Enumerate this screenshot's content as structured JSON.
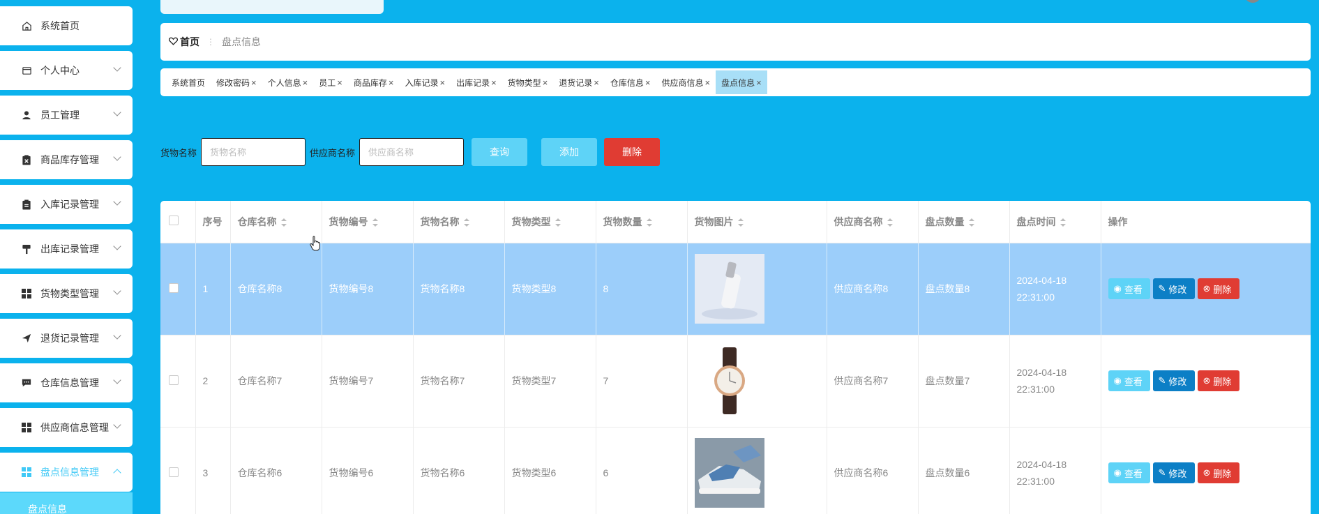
{
  "sidebar": {
    "items": [
      {
        "label": "系统首页",
        "icon": "home-icon",
        "arrow": false
      },
      {
        "label": "个人中心",
        "icon": "wallet-icon",
        "arrow": true
      },
      {
        "label": "员工管理",
        "icon": "user-icon",
        "arrow": true
      },
      {
        "label": "商品库存管理",
        "icon": "clipboard-x-icon",
        "arrow": true
      },
      {
        "label": "入库记录管理",
        "icon": "clipboard-icon",
        "arrow": true
      },
      {
        "label": "出库记录管理",
        "icon": "paint-roller-icon",
        "arrow": true
      },
      {
        "label": "货物类型管理",
        "icon": "grid-icon",
        "arrow": true
      },
      {
        "label": "退货记录管理",
        "icon": "send-icon",
        "arrow": true
      },
      {
        "label": "仓库信息管理",
        "icon": "chat-icon",
        "arrow": true
      },
      {
        "label": "供应商信息管理",
        "icon": "grid-icon",
        "arrow": true
      },
      {
        "label": "盘点信息管理",
        "icon": "grid-icon",
        "arrow": true,
        "active": true
      }
    ],
    "submenu_label": "盘点信息"
  },
  "breadcrumb": {
    "home": "首页",
    "sep": "⋮",
    "current": "盘点信息"
  },
  "tags": [
    {
      "label": "系统首页",
      "closable": false
    },
    {
      "label": "修改密码",
      "closable": true
    },
    {
      "label": "个人信息",
      "closable": true
    },
    {
      "label": "员工",
      "closable": true
    },
    {
      "label": "商品库存",
      "closable": true
    },
    {
      "label": "入库记录",
      "closable": true
    },
    {
      "label": "出库记录",
      "closable": true
    },
    {
      "label": "货物类型",
      "closable": true
    },
    {
      "label": "退货记录",
      "closable": true
    },
    {
      "label": "仓库信息",
      "closable": true
    },
    {
      "label": "供应商信息",
      "closable": true
    },
    {
      "label": "盘点信息",
      "closable": true,
      "active": true
    }
  ],
  "search": {
    "goods_name_label": "货物名称",
    "goods_name_placeholder": "货物名称",
    "supplier_label": "供应商名称",
    "supplier_placeholder": "供应商名称",
    "query_label": "查询",
    "add_label": "添加",
    "delete_label": "删除"
  },
  "table": {
    "headers": [
      "序号",
      "仓库名称",
      "货物编号",
      "货物名称",
      "货物类型",
      "货物数量",
      "货物图片",
      "供应商名称",
      "盘点数量",
      "盘点时间",
      "操作"
    ],
    "rows": [
      {
        "no": "1",
        "warehouse": "仓库名称8",
        "code": "货物编号8",
        "name": "货物名称8",
        "type": "货物类型8",
        "qty": "8",
        "image": "bottle-photo",
        "supplier": "供应商名称8",
        "count": "盘点数量8",
        "time": "2024-04-18 22:31:00",
        "selected": true
      },
      {
        "no": "2",
        "warehouse": "仓库名称7",
        "code": "货物编号7",
        "name": "货物名称7",
        "type": "货物类型7",
        "qty": "7",
        "image": "watch-photo",
        "supplier": "供应商名称7",
        "count": "盘点数量7",
        "time": "2024-04-18 22:31:00",
        "selected": false
      },
      {
        "no": "3",
        "warehouse": "仓库名称6",
        "code": "货物编号6",
        "name": "货物名称6",
        "type": "货物类型6",
        "qty": "6",
        "image": "sneaker-photo",
        "supplier": "供应商名称6",
        "count": "盘点数量6",
        "time": "2024-04-18 22:31:00",
        "selected": false
      }
    ],
    "ops": {
      "view": "查看",
      "edit": "修改",
      "del": "删除"
    }
  },
  "colors": {
    "background": "#0bb2ed",
    "accent": "#5ed3f7",
    "edit": "#0c7fc6",
    "danger": "#e03c33",
    "selected_row": "#9ccefa"
  }
}
